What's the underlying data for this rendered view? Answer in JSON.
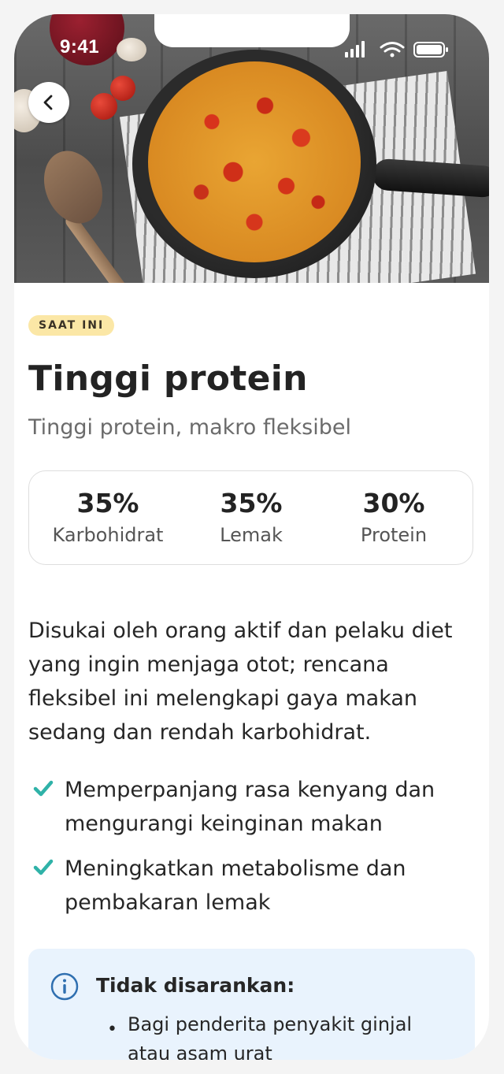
{
  "status_bar": {
    "time": "9:41"
  },
  "hero": {
    "image_alt": "frittata-in-pan"
  },
  "header": {
    "back_icon": "chevron-left-icon"
  },
  "plan": {
    "badge": "SAAT INI",
    "title": "Tinggi protein",
    "subtitle": "Tinggi protein, makro fleksibel",
    "macros": [
      {
        "value": "35%",
        "label": "Karbohidrat"
      },
      {
        "value": "35%",
        "label": "Lemak"
      },
      {
        "value": "30%",
        "label": "Protein"
      }
    ],
    "description": "Disukai oleh orang aktif dan pelaku diet yang ingin menjaga otot; rencana fleksibel ini melengkapi gaya makan sedang dan rendah karbohidrat.",
    "benefits": [
      "Memperpanjang rasa kenyang dan mengurangi keinginan makan",
      "Meningkatkan metabolisme dan pembakaran lemak"
    ],
    "not_recommended": {
      "title": "Tidak disarankan:",
      "items": [
        "Bagi penderita penyakit ginjal atau asam urat"
      ]
    }
  },
  "colors": {
    "accent_check": "#2fb2a8",
    "badge_bg": "#fbe7a6",
    "info_bg": "#e9f3fd",
    "info_icon": "#2f6fb0"
  }
}
